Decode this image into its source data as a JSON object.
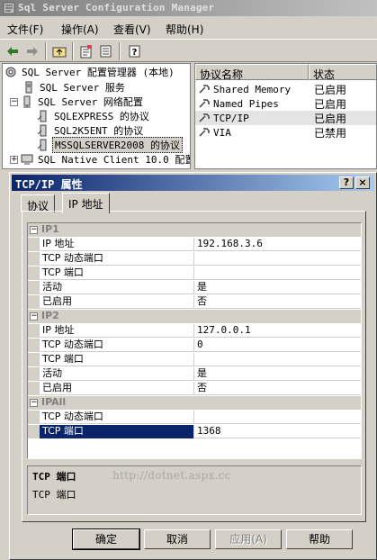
{
  "window": {
    "title": "Sql Server Configuration Manager"
  },
  "menu": [
    {
      "label": "文件(F)"
    },
    {
      "label": "操作(A)"
    },
    {
      "label": "查看(V)"
    },
    {
      "label": "帮助(H)"
    }
  ],
  "toolbar": {
    "icons": [
      "back-arrow-icon",
      "forward-arrow-icon",
      "up-folder-icon",
      "properties-icon",
      "export-list-icon",
      "help-icon"
    ]
  },
  "tree": {
    "root": "SQL Server 配置管理器 (本地)",
    "items": [
      {
        "label": "SQL Server 服务"
      },
      {
        "label": "SQL Server 网络配置"
      },
      {
        "label": "SQLEXPRESS 的协议"
      },
      {
        "label": "SQL2K5ENT 的协议"
      },
      {
        "label": "MSSQLSERVER2008 的协议"
      },
      {
        "label": "SQL Native Client 10.0 配置"
      }
    ]
  },
  "list": {
    "columns": [
      "协议名称",
      "状态"
    ],
    "rows": [
      {
        "name": "Shared Memory",
        "state": "已启用"
      },
      {
        "name": "Named Pipes",
        "state": "已启用"
      },
      {
        "name": "TCP/IP",
        "state": "已启用"
      },
      {
        "name": "VIA",
        "state": "已禁用"
      }
    ]
  },
  "dialog": {
    "title": "TCP/IP 属性",
    "help_glyph": "?",
    "close_glyph": "×",
    "tabs": [
      "协议",
      "IP 地址"
    ],
    "grid": {
      "ip1": {
        "header": "IP1",
        "rows": [
          {
            "k": "IP 地址",
            "v": "192.168.3.6"
          },
          {
            "k": "TCP 动态端口",
            "v": ""
          },
          {
            "k": "TCP 端口",
            "v": ""
          },
          {
            "k": "活动",
            "v": "是"
          },
          {
            "k": "已启用",
            "v": "否"
          }
        ]
      },
      "ip2": {
        "header": "IP2",
        "rows": [
          {
            "k": "IP 地址",
            "v": "127.0.0.1"
          },
          {
            "k": "TCP 动态端口",
            "v": "0"
          },
          {
            "k": "TCP 端口",
            "v": ""
          },
          {
            "k": "活动",
            "v": "是"
          },
          {
            "k": "已启用",
            "v": "否"
          }
        ]
      },
      "ipall": {
        "header": "IPAll",
        "rows": [
          {
            "k": "TCP 动态端口",
            "v": ""
          },
          {
            "k": "TCP 端口",
            "v": "1368"
          }
        ]
      }
    },
    "description": {
      "title": "TCP 端口",
      "text": "TCP 端口"
    },
    "watermark": "http://dotnet.aspx.cc",
    "buttons": {
      "ok": "确定",
      "cancel": "取消",
      "apply": "应用(A)",
      "help": "帮助"
    }
  }
}
